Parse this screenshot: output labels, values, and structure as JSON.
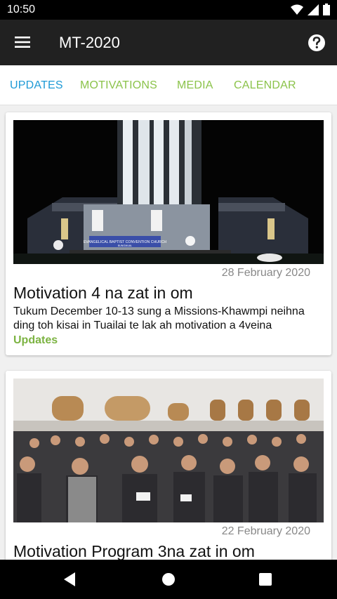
{
  "status_bar": {
    "time": "10:50"
  },
  "app_bar": {
    "title": "MT-2020"
  },
  "tabs": [
    {
      "label": "UPDATES"
    },
    {
      "label": "MOTIVATIONS"
    },
    {
      "label": "MEDIA"
    },
    {
      "label": "CALENDAR"
    }
  ],
  "posts": [
    {
      "date": "28 February 2020",
      "title": "Motivation 4 na zat in om",
      "description": "Tukum December 10-13 sung a Missions-Khawmpi neihna ding toh kisai in Tuailai te lak ah motivation a 4veina",
      "category": "Updates",
      "image_sign": "EVANGELICAL BAPTIST CONVENTION CHURCH",
      "image_sign_sub": "BUNGMUAL"
    },
    {
      "date": "22 February 2020",
      "title": "Motivation Program 3na zat in om"
    }
  ],
  "colors": {
    "active_tab": "#1e9ad6",
    "inactive_tab": "#8bc34a",
    "category": "#7cb342",
    "app_bar": "#212121"
  }
}
